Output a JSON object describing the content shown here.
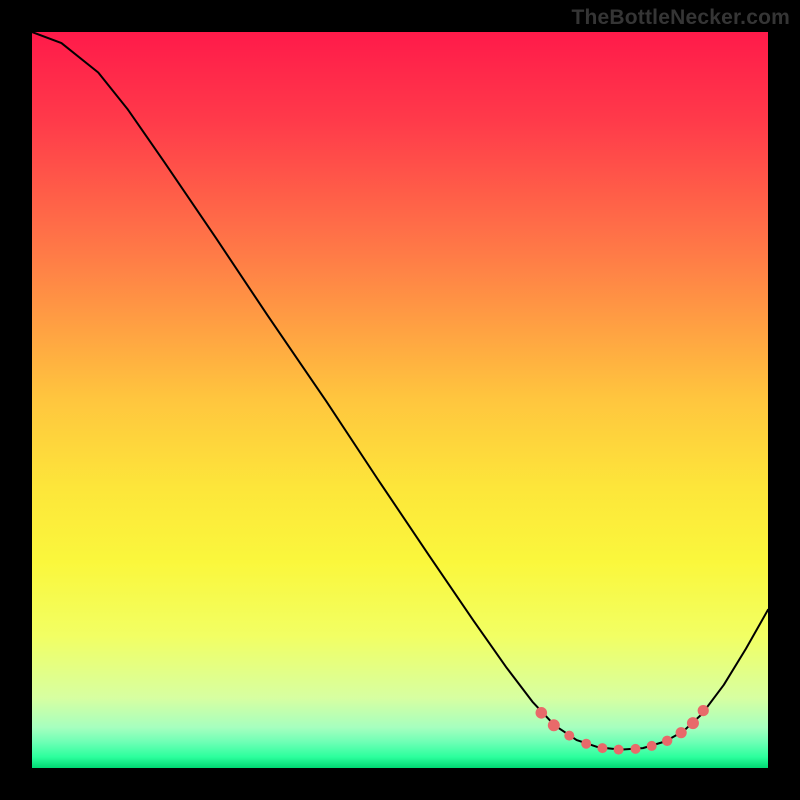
{
  "watermark": "TheBottleNecker.com",
  "chart_data": {
    "type": "line",
    "title": "",
    "xlabel": "",
    "ylabel": "",
    "xlim": [
      0,
      1
    ],
    "ylim": [
      0,
      1
    ],
    "background_gradient": {
      "stops": [
        {
          "offset": 0.0,
          "color": "#ff1a4a"
        },
        {
          "offset": 0.12,
          "color": "#ff3a4a"
        },
        {
          "offset": 0.3,
          "color": "#ff7a47"
        },
        {
          "offset": 0.5,
          "color": "#ffc63e"
        },
        {
          "offset": 0.62,
          "color": "#fde63a"
        },
        {
          "offset": 0.72,
          "color": "#faf73c"
        },
        {
          "offset": 0.82,
          "color": "#f2ff63"
        },
        {
          "offset": 0.905,
          "color": "#d7ffa1"
        },
        {
          "offset": 0.945,
          "color": "#a6ffbf"
        },
        {
          "offset": 0.965,
          "color": "#6dffb5"
        },
        {
          "offset": 0.985,
          "color": "#2cff9d"
        },
        {
          "offset": 1.0,
          "color": "#00d873"
        }
      ]
    },
    "series": [
      {
        "name": "bottleneck-curve",
        "stroke": "#000000",
        "stroke_width": 2,
        "points": [
          {
            "x": 0.0,
            "y": 1.0
          },
          {
            "x": 0.04,
            "y": 0.985
          },
          {
            "x": 0.09,
            "y": 0.945
          },
          {
            "x": 0.13,
            "y": 0.895
          },
          {
            "x": 0.18,
            "y": 0.823
          },
          {
            "x": 0.25,
            "y": 0.72
          },
          {
            "x": 0.32,
            "y": 0.615
          },
          {
            "x": 0.4,
            "y": 0.498
          },
          {
            "x": 0.47,
            "y": 0.392
          },
          {
            "x": 0.54,
            "y": 0.288
          },
          {
            "x": 0.6,
            "y": 0.2
          },
          {
            "x": 0.645,
            "y": 0.136
          },
          {
            "x": 0.68,
            "y": 0.09
          },
          {
            "x": 0.71,
            "y": 0.058
          },
          {
            "x": 0.74,
            "y": 0.038
          },
          {
            "x": 0.77,
            "y": 0.028
          },
          {
            "x": 0.8,
            "y": 0.025
          },
          {
            "x": 0.83,
            "y": 0.027
          },
          {
            "x": 0.86,
            "y": 0.036
          },
          {
            "x": 0.885,
            "y": 0.05
          },
          {
            "x": 0.91,
            "y": 0.073
          },
          {
            "x": 0.94,
            "y": 0.113
          },
          {
            "x": 0.97,
            "y": 0.162
          },
          {
            "x": 1.0,
            "y": 0.215
          }
        ]
      }
    ],
    "markers": {
      "name": "optimal-zone",
      "color": "#e86a6a",
      "points": [
        {
          "x": 0.692,
          "y": 0.075,
          "r": 5.8
        },
        {
          "x": 0.709,
          "y": 0.058,
          "r": 6.0
        },
        {
          "x": 0.73,
          "y": 0.044,
          "r": 5.0
        },
        {
          "x": 0.753,
          "y": 0.033,
          "r": 5.0
        },
        {
          "x": 0.775,
          "y": 0.027,
          "r": 5.0
        },
        {
          "x": 0.797,
          "y": 0.025,
          "r": 5.0
        },
        {
          "x": 0.82,
          "y": 0.026,
          "r": 5.0
        },
        {
          "x": 0.842,
          "y": 0.03,
          "r": 5.0
        },
        {
          "x": 0.863,
          "y": 0.037,
          "r": 5.2
        },
        {
          "x": 0.882,
          "y": 0.048,
          "r": 5.6
        },
        {
          "x": 0.898,
          "y": 0.061,
          "r": 6.0
        },
        {
          "x": 0.912,
          "y": 0.078,
          "r": 5.6
        }
      ]
    }
  }
}
